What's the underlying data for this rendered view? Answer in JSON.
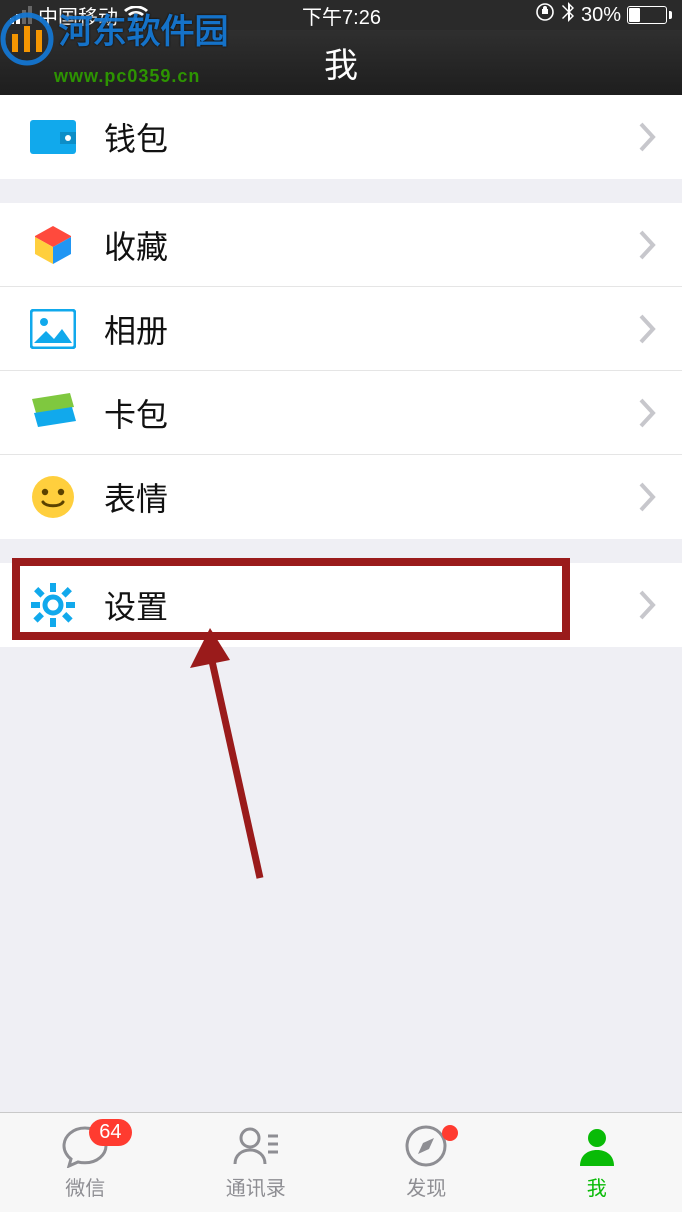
{
  "statusbar": {
    "carrier": "中国移动",
    "time": "下午7:26",
    "battery_pct": "30%"
  },
  "header": {
    "title": "我"
  },
  "watermark": {
    "line1": "河东软件园",
    "line2": "www.pc0359.cn"
  },
  "groups": [
    {
      "rows": [
        {
          "key": "wallet",
          "label": "钱包"
        }
      ]
    },
    {
      "rows": [
        {
          "key": "favorites",
          "label": "收藏"
        },
        {
          "key": "album",
          "label": "相册"
        },
        {
          "key": "cards",
          "label": "卡包"
        },
        {
          "key": "stickers",
          "label": "表情"
        }
      ]
    },
    {
      "rows": [
        {
          "key": "settings",
          "label": "设置"
        }
      ]
    }
  ],
  "tabs": {
    "chats": {
      "label": "微信",
      "badge": "64"
    },
    "contacts": {
      "label": "通讯录"
    },
    "discover": {
      "label": "发现",
      "dot": true
    },
    "me": {
      "label": "我",
      "active": true
    }
  }
}
